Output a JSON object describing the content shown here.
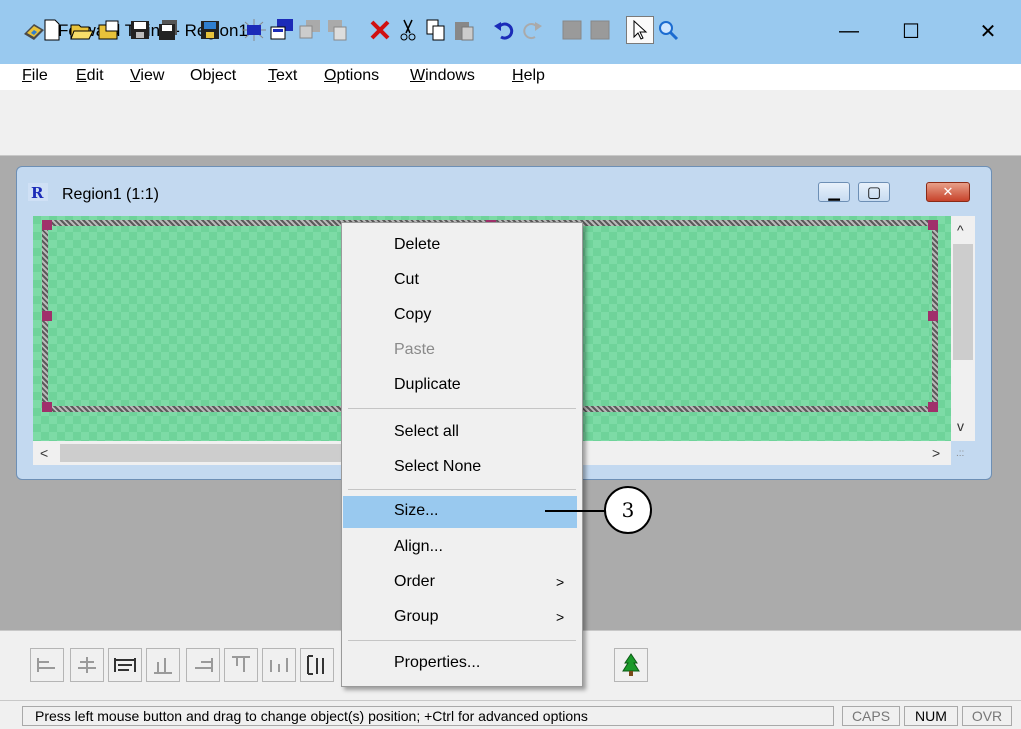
{
  "window": {
    "title": "Forward Titling - Region1",
    "controls": {
      "minimize": "—",
      "maximize": "☐",
      "close": "✕"
    }
  },
  "menubar": {
    "items": [
      {
        "label": "File",
        "accel": "F",
        "rest": "ile"
      },
      {
        "label": "Edit",
        "accel": "E",
        "rest": "dit"
      },
      {
        "label": "View",
        "accel": "V",
        "rest": "iew"
      },
      {
        "label": "Object",
        "accel": "",
        "rest": "Object"
      },
      {
        "label": "Text",
        "accel": "T",
        "rest": "ext"
      },
      {
        "label": "Options",
        "accel": "O",
        "rest": "ptions"
      },
      {
        "label": "Windows",
        "accel": "W",
        "rest": "indows"
      },
      {
        "label": "Help",
        "accel": "H",
        "rest": "elp"
      }
    ]
  },
  "toolbar": {
    "icons": [
      "new-icon",
      "open-icon",
      "open-print-icon",
      "save-icon",
      "save-all-icon",
      "save-project-icon",
      "capture-icon",
      "import-icon",
      "copy-style-icon",
      "paste-style-icon",
      "delete-icon",
      "cut-icon",
      "copy-icon",
      "paste-icon",
      "undo-icon",
      "redo-icon",
      "group-a-icon",
      "group-b-icon",
      "pointer-icon",
      "zoom-icon"
    ]
  },
  "child": {
    "title": "Region1  (1:1)",
    "icon_letter": "R",
    "controls": {
      "minimize": "▁",
      "restore": "▢",
      "close": "✕"
    }
  },
  "scroll": {
    "up": "^",
    "down": "v",
    "left": "<",
    "right": ">",
    "grip": ".::"
  },
  "context_menu": {
    "items": [
      {
        "label": "Delete",
        "enabled": true
      },
      {
        "label": "Cut",
        "enabled": true
      },
      {
        "label": "Copy",
        "enabled": true
      },
      {
        "label": "Paste",
        "enabled": false
      },
      {
        "label": "Duplicate",
        "enabled": true
      },
      {
        "label": "Select all",
        "enabled": true
      },
      {
        "label": "Select None",
        "enabled": true
      },
      {
        "label": "Size...",
        "enabled": true,
        "highlighted": true
      },
      {
        "label": "Align...",
        "enabled": true
      },
      {
        "label": "Order",
        "enabled": true,
        "submenu": ">"
      },
      {
        "label": "Group",
        "enabled": true,
        "submenu": ">"
      },
      {
        "label": "Properties...",
        "enabled": true
      }
    ]
  },
  "callout": {
    "number": "3"
  },
  "bottom_toolbar": {
    "icons": [
      "align-left-icon",
      "align-center-icon",
      "align-width-icon",
      "align-bottom-icon",
      "align-right-icon",
      "align-top-icon",
      "distribute-icon",
      "align-height-icon",
      "tree-icon"
    ]
  },
  "statusbar": {
    "message": "Press left mouse button and drag to change object(s) position; +Ctrl for advanced options",
    "caps": "CAPS",
    "num": "NUM",
    "ovr": "OVR"
  },
  "colors": {
    "titlebar": "#99c9ef",
    "canvas_green": "#6fd39a",
    "handle": "#a0306b",
    "highlight": "#99c9ef",
    "delete_red": "#d01010"
  }
}
